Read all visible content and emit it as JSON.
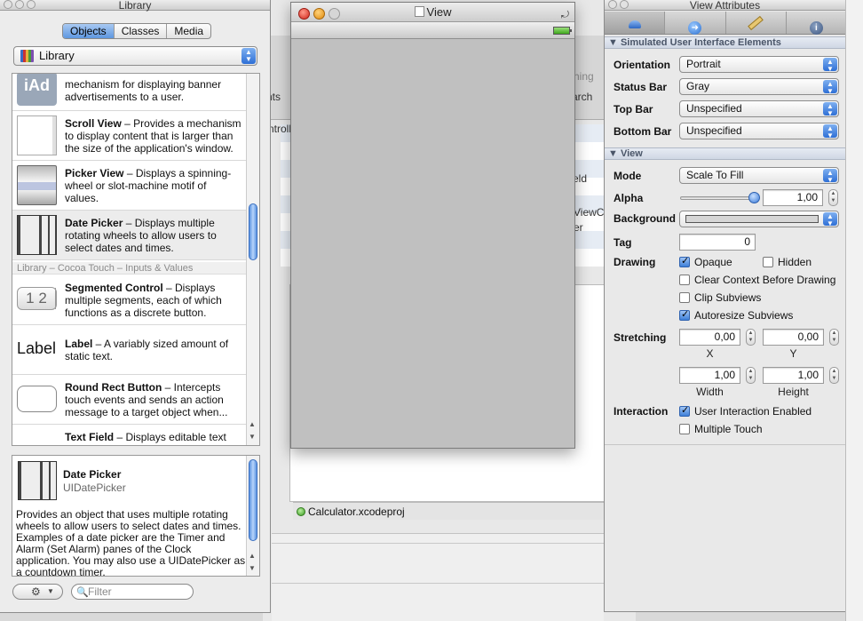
{
  "library": {
    "title": "Library",
    "tabs": [
      "Objects",
      "Classes",
      "Media"
    ],
    "active_tab": "Objects",
    "popup_value": "Library",
    "items": [
      {
        "thumb": "iAd",
        "name": "",
        "desc": "mechanism for displaying banner advertisements to a user."
      },
      {
        "thumb": "",
        "name": "Scroll View",
        "desc": " – Provides a mechanism to display content that is larger than the size of the application's window."
      },
      {
        "thumb": "",
        "name": "Picker View",
        "desc": " – Displays a spinning-wheel or slot-machine motif of values."
      },
      {
        "thumb": "",
        "name": "Date Picker",
        "desc": " – Displays multiple rotating wheels to allow users to select dates and times."
      }
    ],
    "group_header": "Library – Cocoa Touch – Inputs & Values",
    "items2": [
      {
        "thumb": "1 2",
        "name": "Segmented Control",
        "desc": " – Displays multiple segments, each of which functions as a discrete button."
      },
      {
        "thumb": "Label",
        "name": "Label",
        "desc": " – A variably sized amount of static text."
      },
      {
        "thumb": "",
        "name": "Round Rect Button",
        "desc": " – Intercepts touch events and sends an action message to a target object when..."
      },
      {
        "thumb": "",
        "name": "Text Field",
        "desc": " – Displays editable text"
      }
    ],
    "detail": {
      "name": "Date Picker",
      "class": "UIDatePicker",
      "text": "Provides an object that uses multiple rotating wheels to allow users to select dates and times. Examples of a date picker are the Timer and Alarm (Set Alarm) panes of the Clock application. You may also use a UIDatePicker as a countdown timer."
    },
    "filter_placeholder": "Filter",
    "gear_icon": "gear-icon"
  },
  "view_window": {
    "title": "View",
    "background_color": "#c0c0c0"
  },
  "background_window": {
    "fragments": [
      "hing",
      "nts",
      "arch",
      "ntroll",
      "eld",
      "ViewC.",
      "er"
    ],
    "status_file": "Calculator.xcodeproj"
  },
  "inspector": {
    "title": "View Attributes",
    "tabs": [
      "attributes-icon",
      "connections-icon",
      "size-icon",
      "identity-icon"
    ],
    "section_simulated": "Simulated User Interface Elements",
    "orientation_label": "Orientation",
    "orientation_value": "Portrait",
    "status_bar_label": "Status Bar",
    "status_bar_value": "Gray",
    "top_bar_label": "Top Bar",
    "top_bar_value": "Unspecified",
    "bottom_bar_label": "Bottom Bar",
    "bottom_bar_value": "Unspecified",
    "section_view": "View",
    "mode_label": "Mode",
    "mode_value": "Scale To Fill",
    "alpha_label": "Alpha",
    "alpha_value": "1,00",
    "alpha_slider_fraction": 1.0,
    "background_label": "Background",
    "tag_label": "Tag",
    "tag_value": "0",
    "drawing_label": "Drawing",
    "opaque_label": "Opaque",
    "opaque_checked": true,
    "hidden_label": "Hidden",
    "hidden_checked": false,
    "clear_context_label": "Clear Context Before Drawing",
    "clear_context_checked": false,
    "clip_subviews_label": "Clip Subviews",
    "clip_subviews_checked": false,
    "autoresize_label": "Autoresize Subviews",
    "autoresize_checked": true,
    "stretching_label": "Stretching",
    "stretch_x": "0,00",
    "stretch_y": "0,00",
    "x_label": "X",
    "y_label": "Y",
    "stretch_width": "1,00",
    "stretch_height": "1,00",
    "width_label": "Width",
    "height_label": "Height",
    "interaction_label": "Interaction",
    "user_interaction_label": "User Interaction Enabled",
    "user_interaction_checked": true,
    "multiple_touch_label": "Multiple Touch",
    "multiple_touch_checked": false
  }
}
